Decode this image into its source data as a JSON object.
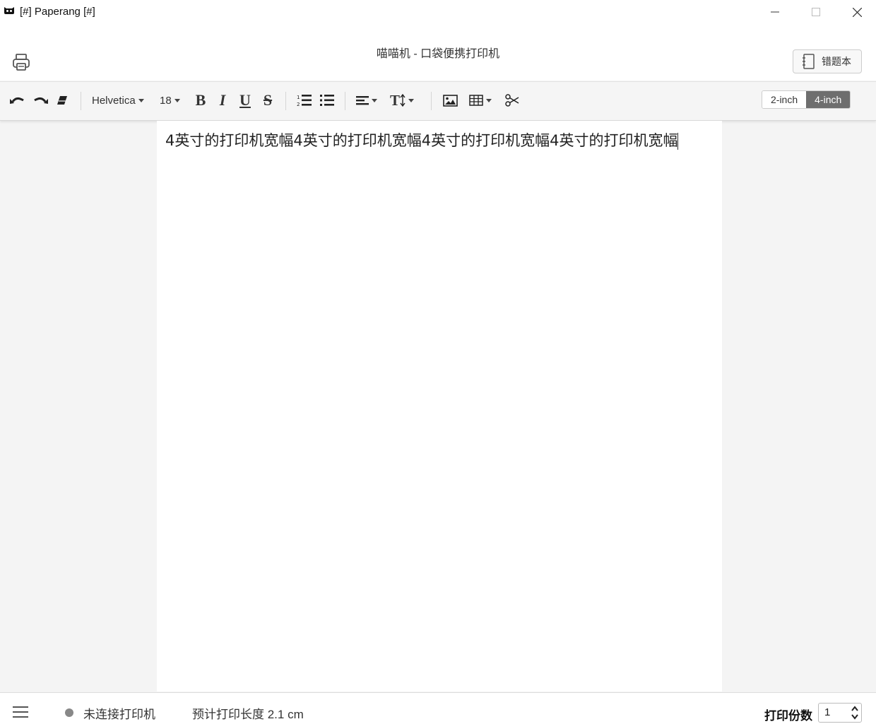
{
  "window": {
    "title": "[#] Paperang [#]",
    "icon": "cat-icon"
  },
  "header": {
    "app_title": "喵喵机 - 口袋便携打印机",
    "error_book_label": "错题本"
  },
  "toolbar": {
    "font_family": "Helvetica",
    "font_size": "18",
    "bold": "B",
    "italic": "I",
    "underline": "U",
    "strike": "S",
    "text_size": "T",
    "width_options": [
      "2-inch",
      "4-inch"
    ],
    "selected_width": "4-inch"
  },
  "editor": {
    "content": "4英寸的打印机宽幅4英寸的打印机宽幅4英寸的打印机宽幅4英寸的打印机宽幅"
  },
  "status": {
    "connection": "未连接打印机",
    "estimated_length": "预计打印长度 2.1 cm",
    "copies_label": "打印份数",
    "copies_value": "1"
  },
  "colors": {
    "selected_segment": "#6e6e6e",
    "status_dot": "#888888"
  }
}
